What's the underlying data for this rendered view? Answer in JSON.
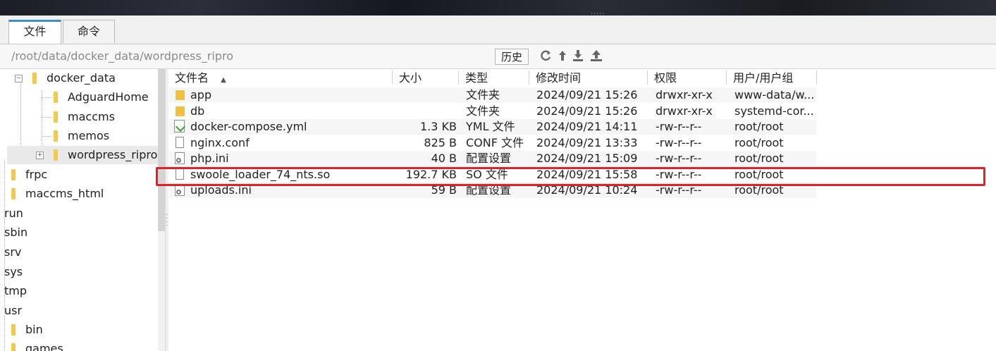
{
  "tabs": [
    {
      "label": "文件",
      "active": true
    },
    {
      "label": "命令",
      "active": false
    }
  ],
  "path": {
    "value": "/root/data/docker_data/wordpress_ripro",
    "history_label": "历史"
  },
  "toolbar_icons": [
    "refresh-icon",
    "upload-icon",
    "download-icon",
    "upload-folder-icon"
  ],
  "tree": [
    {
      "label": "docker_data",
      "level": 1,
      "expander": "minus"
    },
    {
      "label": "AdguardHome",
      "level": 2
    },
    {
      "label": "maccms",
      "level": 2
    },
    {
      "label": "memos",
      "level": 2
    },
    {
      "label": "wordpress_ripro",
      "level": 2,
      "expander": "plus",
      "selected": true
    },
    {
      "label": "frpc",
      "level": 0
    },
    {
      "label": "maccms_html",
      "level": 0
    },
    {
      "label": "run",
      "level": -1
    },
    {
      "label": "sbin",
      "level": -1
    },
    {
      "label": "srv",
      "level": -1
    },
    {
      "label": "sys",
      "level": -1
    },
    {
      "label": "tmp",
      "level": -1
    },
    {
      "label": "usr",
      "level": -1
    },
    {
      "label": "bin",
      "level": 0
    },
    {
      "label": "games",
      "level": 0
    }
  ],
  "columns": {
    "name": "文件名",
    "size": "大小",
    "type": "类型",
    "mtime": "修改时间",
    "perm": "权限",
    "owner": "用户/用户组"
  },
  "files": [
    {
      "icon": "folder",
      "name": "app",
      "size": "",
      "type": "文件夹",
      "mtime": "2024/09/21 15:26",
      "perm": "drwxr-xr-x",
      "owner": "www-data/w..."
    },
    {
      "icon": "folder",
      "name": "db",
      "size": "",
      "type": "文件夹",
      "mtime": "2024/09/21 15:26",
      "perm": "drwxr-xr-x",
      "owner": "systemd-cor..."
    },
    {
      "icon": "yml",
      "name": "docker-compose.yml",
      "size": "1.3 KB",
      "type": "YML 文件",
      "mtime": "2024/09/21 14:11",
      "perm": "-rw-r--r--",
      "owner": "root/root"
    },
    {
      "icon": "file",
      "name": "nginx.conf",
      "size": "825 B",
      "type": "CONF 文件",
      "mtime": "2024/09/21 13:33",
      "perm": "-rw-r--r--",
      "owner": "root/root"
    },
    {
      "icon": "gear",
      "name": "php.ini",
      "size": "40 B",
      "type": "配置设置",
      "mtime": "2024/09/21 15:09",
      "perm": "-rw-r--r--",
      "owner": "root/root"
    },
    {
      "icon": "file",
      "name": "swoole_loader_74_nts.so",
      "size": "192.7 KB",
      "type": "SO 文件",
      "mtime": "2024/09/21 15:58",
      "perm": "-rw-r--r--",
      "owner": "root/root",
      "highlighted": true
    },
    {
      "icon": "gear",
      "name": "uploads.ini",
      "size": "59 B",
      "type": "配置设置",
      "mtime": "2024/09/21 10:24",
      "perm": "-rw-r--r--",
      "owner": "root/root"
    }
  ],
  "colors": {
    "highlight_border": "#e0202a",
    "tab_accent": "#3c8dd6",
    "folder": "#f0c040"
  }
}
